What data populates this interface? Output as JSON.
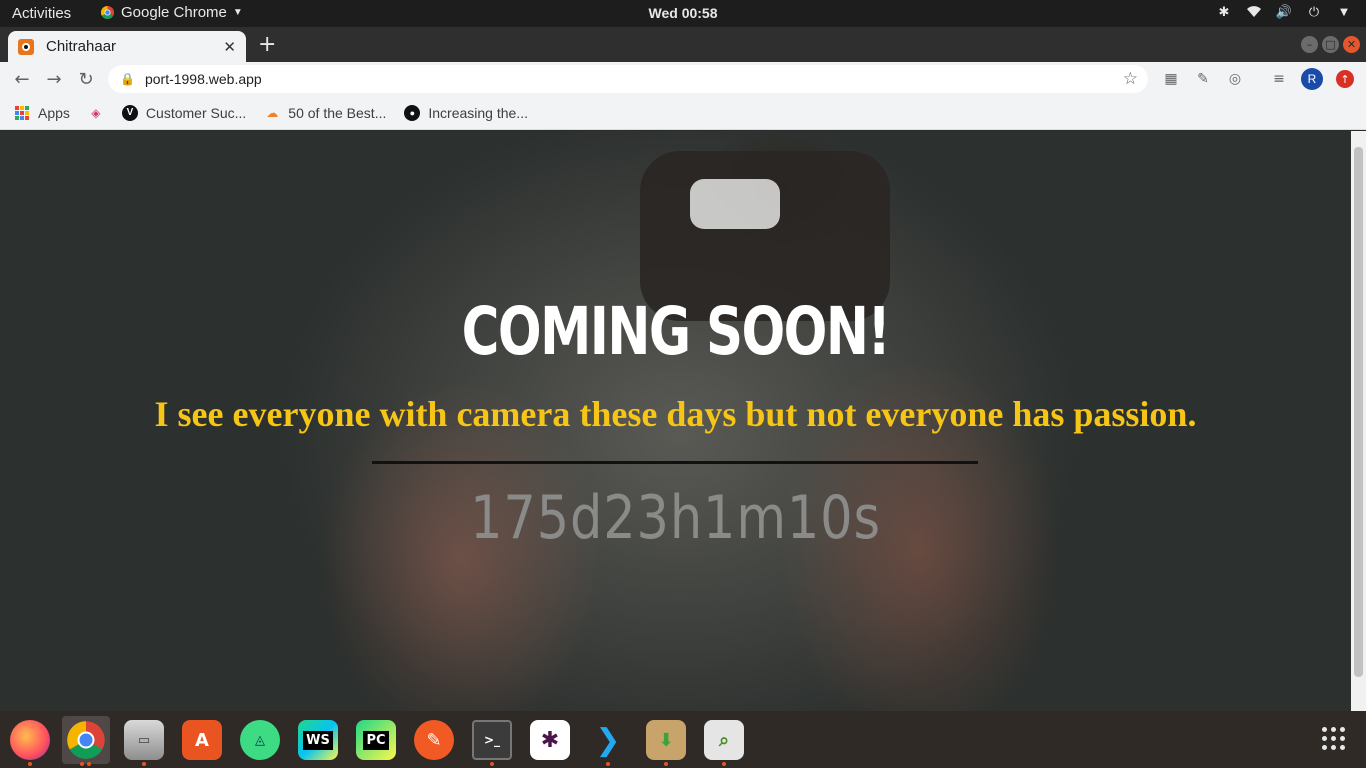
{
  "system": {
    "activities": "Activities",
    "app_menu": "Google Chrome",
    "clock": "Wed 00:58"
  },
  "browser": {
    "tab_title": "Chitrahaar",
    "url": "port-1998.web.app",
    "avatar_letter": "R",
    "bookmarks": [
      {
        "label": "Apps",
        "icon": "apps-grid-icon"
      },
      {
        "label": "",
        "icon": "cube-icon"
      },
      {
        "label": "Customer Suc...",
        "icon": "vimeo-icon"
      },
      {
        "label": "50 of the Best...",
        "icon": "cloud-icon"
      },
      {
        "label": "Increasing the...",
        "icon": "github-icon"
      }
    ]
  },
  "page": {
    "headline": "COMING SOON!",
    "tagline": "I see everyone with camera these days but not everyone has passion.",
    "countdown": "175d23h1m10s"
  },
  "dock": {
    "apps": [
      "firefox",
      "chrome",
      "files",
      "software",
      "android-studio",
      "webstorm",
      "pycharm",
      "inkscape",
      "terminal",
      "slack",
      "vscode",
      "archive-manager",
      "image-viewer"
    ]
  },
  "colors": {
    "accent_yellow": "#f5c518",
    "countdown_gray": "#8a8a88",
    "ubuntu_orange": "#e95420"
  }
}
